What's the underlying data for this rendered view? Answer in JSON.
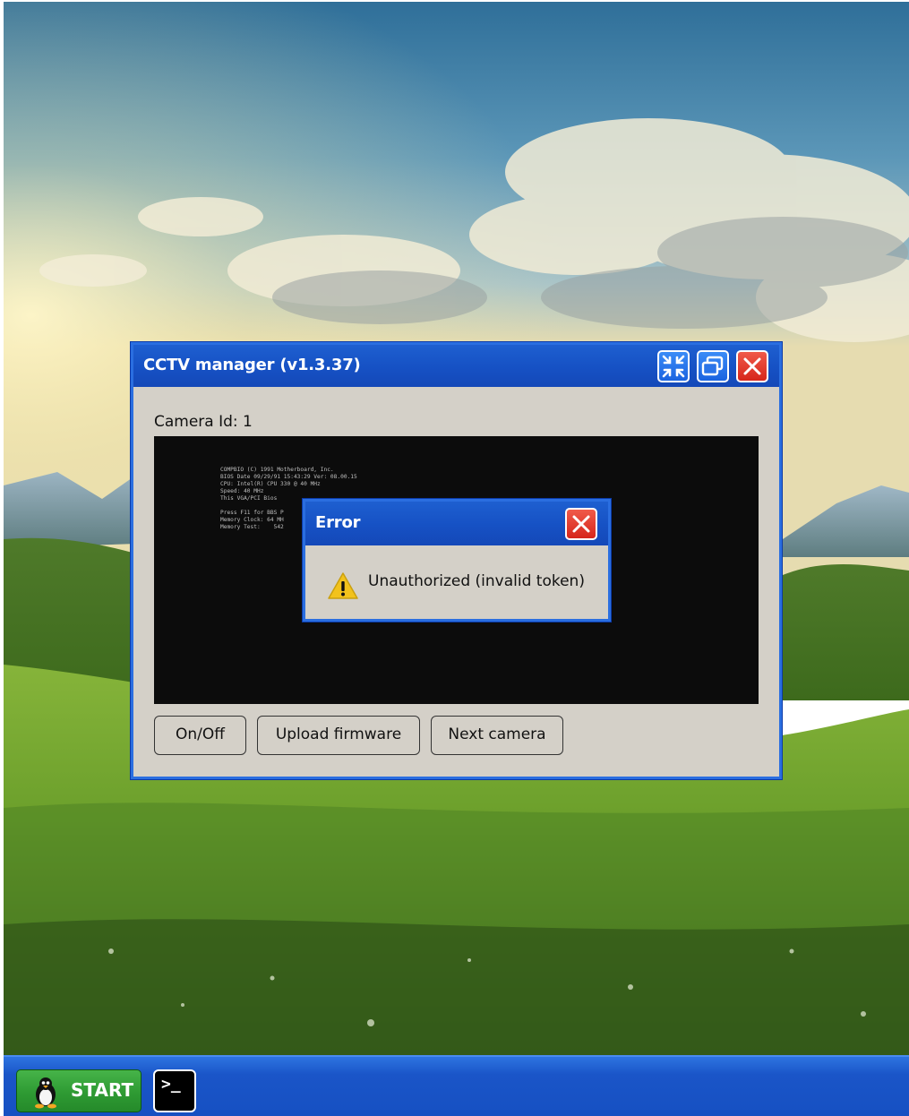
{
  "window": {
    "title": "CCTV manager (v1.3.37)",
    "camera_label": "Camera Id: 1",
    "bios_lines": [
      "COMPBIO (C) 1991 Motherboard, Inc.",
      "BIOS Date 09/29/91 15:43:29 Ver: 08.00.15",
      "CPU: Intel(R) CPU 330 @ 40 MHz",
      "Speed: 40 MHz",
      "This VGA/PCI Bios",
      "",
      "Press F11 for BBS P",
      "Memory Clock: 64 MH",
      "Memory Test:    542"
    ],
    "buttons": {
      "onoff": "On/Off",
      "upload": "Upload firmware",
      "next": "Next camera"
    },
    "title_buttons": [
      "shrink-icon",
      "restore-icon",
      "close-icon"
    ]
  },
  "dialog": {
    "title": "Error",
    "message": "Unauthorized (invalid token)",
    "icon": "warning-icon"
  },
  "taskbar": {
    "start_label": "START",
    "terminal_prompt": ">_"
  },
  "colors": {
    "titlebar": "#1651c4",
    "window_bg": "#d4d0c8",
    "close_red": "#d6261b",
    "start_green": "#2e9a33",
    "taskbar": "#1a55c8"
  }
}
